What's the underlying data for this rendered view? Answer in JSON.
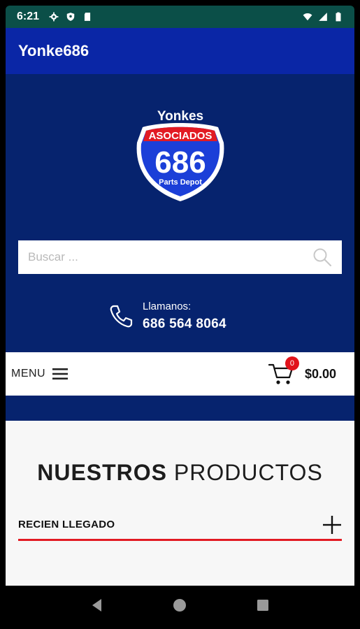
{
  "status": {
    "time": "6:21",
    "icons_left": [
      "gear-icon",
      "shield-icon",
      "sd-card-icon"
    ],
    "icons_right": [
      "wifi-icon",
      "cellular-icon",
      "battery-icon"
    ]
  },
  "appbar": {
    "title": "Yonke686"
  },
  "logo": {
    "top_text": "Yonkes",
    "banner_text": "ASOCIADOS",
    "number": "686",
    "sub_text": "Parts Depot"
  },
  "search": {
    "placeholder": "Buscar ..."
  },
  "contact": {
    "label": "Llamanos:",
    "phone": "686 564 8064"
  },
  "menubar": {
    "menu_label": "MENU",
    "cart_count": "0",
    "cart_total": "$0.00"
  },
  "products": {
    "title_bold": "NUESTROS",
    "title_light": "PRODUCTOS",
    "accordion_label": "RECIEN LLEGADO"
  },
  "colors": {
    "appbar": "#0a26a6",
    "hero": "#06236e",
    "statusbar": "#0b4f48",
    "accent_red": "#e21a23"
  },
  "nav": {
    "buttons": [
      "back-icon",
      "home-icon",
      "recents-icon"
    ]
  }
}
